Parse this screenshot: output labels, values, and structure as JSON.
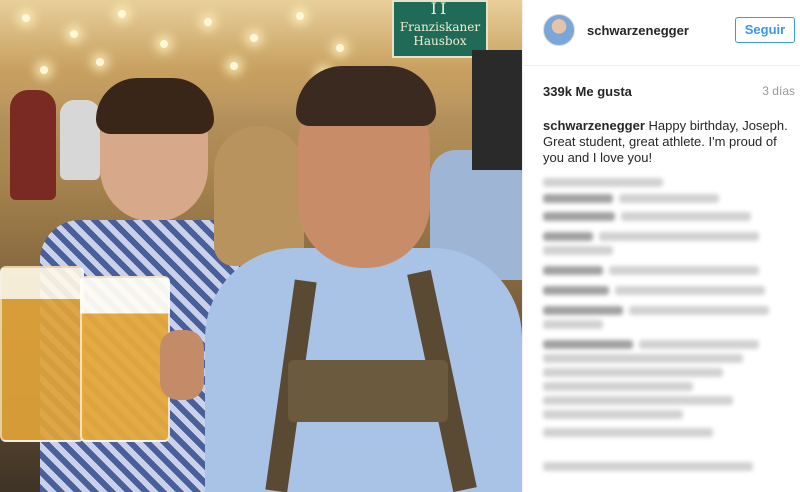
{
  "post": {
    "username": "schwarzenegger",
    "follow_label": "Seguir",
    "likes": "339k Me gusta",
    "time_ago": "3 días",
    "caption_user": "schwarzenegger",
    "caption_text": "Happy birthday, Joseph. Great student, great athlete. I'm proud of you and I love you!"
  },
  "photo": {
    "sign_mark": "II",
    "sign_line1": "Franziskaner",
    "sign_line2": "Hausbox"
  },
  "colors": {
    "accent": "#3897f0",
    "text": "#262626",
    "muted": "#999999",
    "border": "#efefef"
  }
}
